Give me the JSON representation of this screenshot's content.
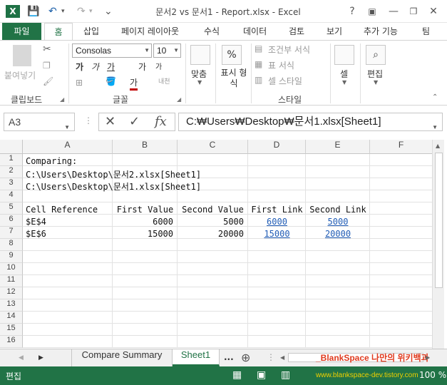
{
  "window": {
    "app_logo": "X",
    "title": "문서2 vs 문서1 - Report.xlsx - Excel",
    "controls": {
      "help": "?",
      "ribbon_options": "▣",
      "minimize": "—",
      "restore": "❐",
      "close": "✕"
    },
    "quick_access": {
      "save": "💾",
      "undo": "↶",
      "redo": "↷",
      "customize": "⌄"
    }
  },
  "ribbon": {
    "file_tab": "파일",
    "tabs": [
      "홈",
      "삽입",
      "페이지 레이아웃",
      "수식",
      "데이터",
      "검토",
      "보기",
      "추가 기능",
      "팀"
    ],
    "active_tab": "홈",
    "clipboard": {
      "paste": "붙여넣기",
      "label": "클립보드"
    },
    "font": {
      "name": "Consolas",
      "size": "10",
      "label": "글꼴",
      "bold": "가",
      "italic": "가",
      "underline": "가",
      "grow": "가",
      "shrink": "가",
      "font_color": "가",
      "phonetic": "내천"
    },
    "alignment": {
      "label": "맞춤"
    },
    "number": {
      "percent": "%",
      "label": "표시 형식"
    },
    "styles": {
      "conditional": "조건부 서식",
      "table": "표 서식",
      "cell_styles": "셀 스타일",
      "label": "스타일"
    },
    "cells": {
      "label": "셀"
    },
    "editing": {
      "label": "편집"
    }
  },
  "formula_bar": {
    "name_box": "A3",
    "cancel": "✕",
    "enter": "✓",
    "fx": "fx",
    "formula": "C:₩Users₩Desktop₩문서1.xlsx[Sheet1]"
  },
  "grid": {
    "columns": [
      "A",
      "B",
      "C",
      "D",
      "E",
      "F"
    ],
    "rows": [
      "1",
      "2",
      "3",
      "4",
      "5",
      "6",
      "7",
      "8",
      "9",
      "10",
      "11",
      "12",
      "13",
      "14",
      "15",
      "16"
    ],
    "cells": {
      "a1": "Comparing:",
      "a2": "C:\\Users\\Desktop\\문서2.xlsx[Sheet1]",
      "a3": "C:\\Users\\Desktop\\문서1.xlsx[Sheet1]",
      "a5": "Cell Reference",
      "b5": "First Value",
      "c5": "Second Value",
      "d5": "First Link",
      "e5": "Second Link",
      "a6": "$E$4",
      "b6": "6000",
      "c6": "5000",
      "d6": "6000",
      "e6": "5000",
      "a7": "$E$6",
      "b7": "15000",
      "c7": "20000",
      "d7": "15000",
      "e7": "20000"
    }
  },
  "sheets": {
    "tabs": [
      "Compare Summary",
      "Sheet1"
    ],
    "active": "Sheet1",
    "more": "...",
    "add": "⊕",
    "watermark": "_BlankSpace 나만의 위키백과"
  },
  "status": {
    "mode": "편집",
    "watermark": "www.blankspace-dev.tistory.com",
    "zoom": "100 %"
  },
  "colors": {
    "brand": "#217346",
    "link": "#1f5bb5",
    "watermark": "#e03a1e"
  }
}
